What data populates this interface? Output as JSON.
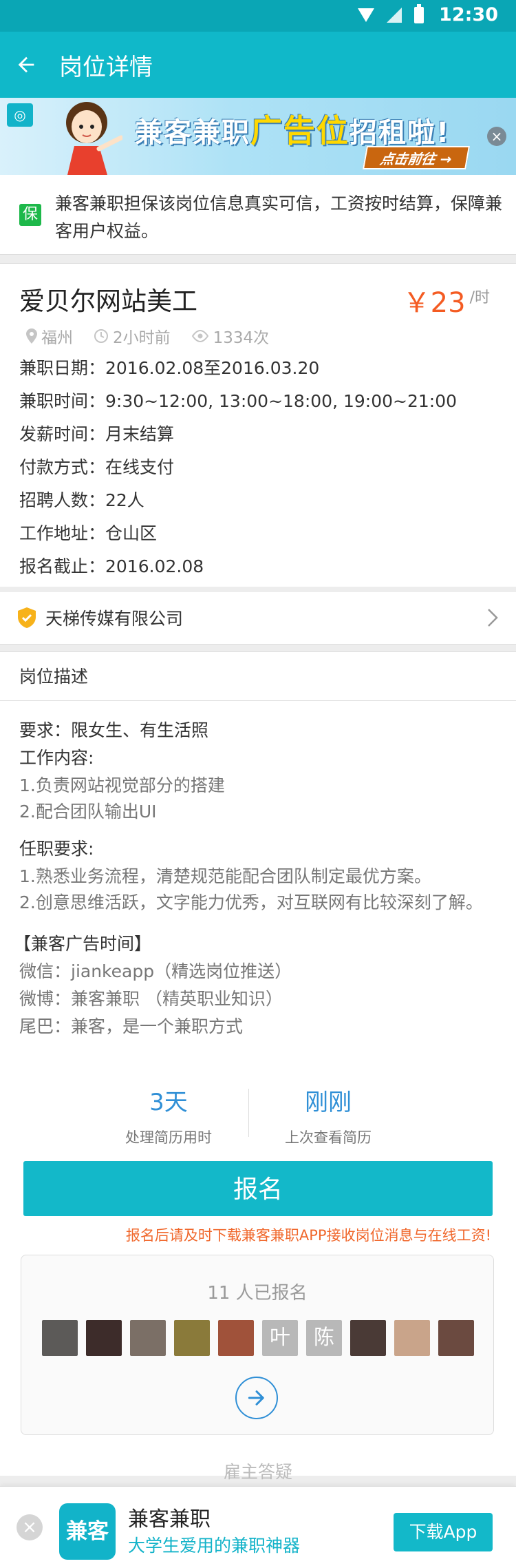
{
  "status_bar": {
    "time": "12:30"
  },
  "appbar": {
    "title": "岗位详情"
  },
  "banner": {
    "text_pre": "兼客兼职",
    "text_highlight": "广告位",
    "text_post": "招租啦!",
    "cta": "点击前往 →"
  },
  "guarantee": {
    "badge": "保",
    "text": "兼客兼职担保该岗位信息真实可信，工资按时结算，保障兼客用户权益。"
  },
  "job": {
    "title": "爱贝尔网站美工",
    "salary": "￥23",
    "salary_unit": "/时",
    "location": "福州",
    "posted": "2小时前",
    "views": "1334次",
    "rows": [
      "兼职日期：2016.02.08至2016.03.20",
      "兼职时间：9:30~12:00, 13:00~18:00, 19:00~21:00",
      "发薪时间：月末结算",
      "付款方式：在线支付",
      "招聘人数：22人",
      "工作地址：仓山区",
      "报名截止：2016.02.08"
    ]
  },
  "company": {
    "name": "天梯传媒有限公司"
  },
  "description": {
    "heading": "岗位描述",
    "requirement": "要求：限女生、有生活照",
    "content_title": "工作内容:",
    "content": [
      "1.负责网站视觉部分的搭建",
      "2.配合团队输出UI"
    ],
    "duty_title": "任职要求:",
    "duty": [
      "1.熟悉业务流程，清楚规范能配合团队制定最优方案。",
      "2.创意思维活跃，文字能力优秀，对互联网有比较深刻了解。"
    ],
    "ad_title": "【兼客广告时间】",
    "ad_lines": [
      "微信：jiankeapp（精选岗位推送）",
      "微博：兼客兼职 （精英职业知识）",
      "尾巴：兼客，是一个兼职方式"
    ]
  },
  "stats": [
    {
      "value": "3天",
      "label": "处理简历用时"
    },
    {
      "value": "刚刚",
      "label": "上次查看简历"
    }
  ],
  "signup": {
    "button": "报名",
    "tip": "报名后请及时下载兼客兼职APP接收岗位消息与在线工资!"
  },
  "applied": {
    "count_text": "11 人已报名",
    "avatars": [
      {
        "char": "",
        "color": "#5c5a58"
      },
      {
        "char": "",
        "color": "#3d2c2a"
      },
      {
        "char": "",
        "color": "#7b6f66"
      },
      {
        "char": "",
        "color": "#8a7a3a"
      },
      {
        "char": "",
        "color": "#a0523a"
      },
      {
        "char": "叶",
        "color": "#b8b8b8"
      },
      {
        "char": "陈",
        "color": "#b8b8b8"
      },
      {
        "char": "",
        "color": "#4a3a36"
      },
      {
        "char": "",
        "color": "#c9a48a"
      },
      {
        "char": "",
        "color": "#6b4a40"
      }
    ]
  },
  "qa_peek": "雇主答疑",
  "download_bar": {
    "logo": "兼客",
    "app_name": "兼客兼职",
    "slogan": "大学生爱用的兼职神器",
    "button": "下载App"
  }
}
